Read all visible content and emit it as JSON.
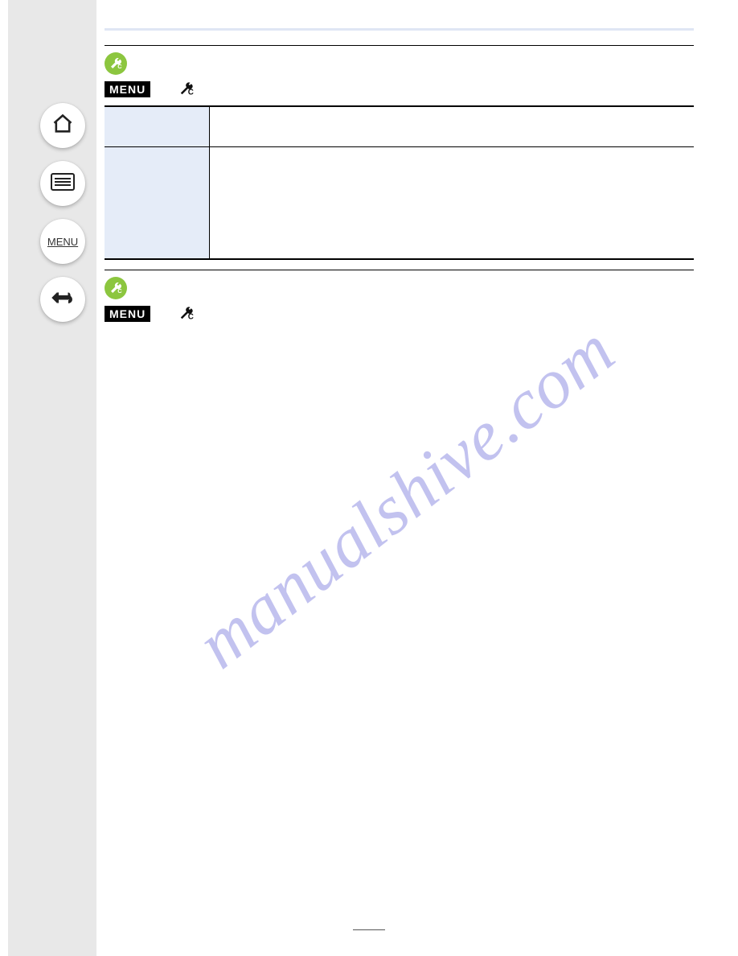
{
  "sidebar": {
    "buttons": {
      "home": "home-icon",
      "list": "list-icon",
      "menu": "MENU",
      "back": "back-icon"
    }
  },
  "sections": [
    {
      "menu_label": "MENU",
      "table": [
        {
          "key": "",
          "val": ""
        },
        {
          "key": "",
          "val": ""
        }
      ]
    },
    {
      "menu_label": "MENU"
    }
  ],
  "watermark": "manualshive.com"
}
